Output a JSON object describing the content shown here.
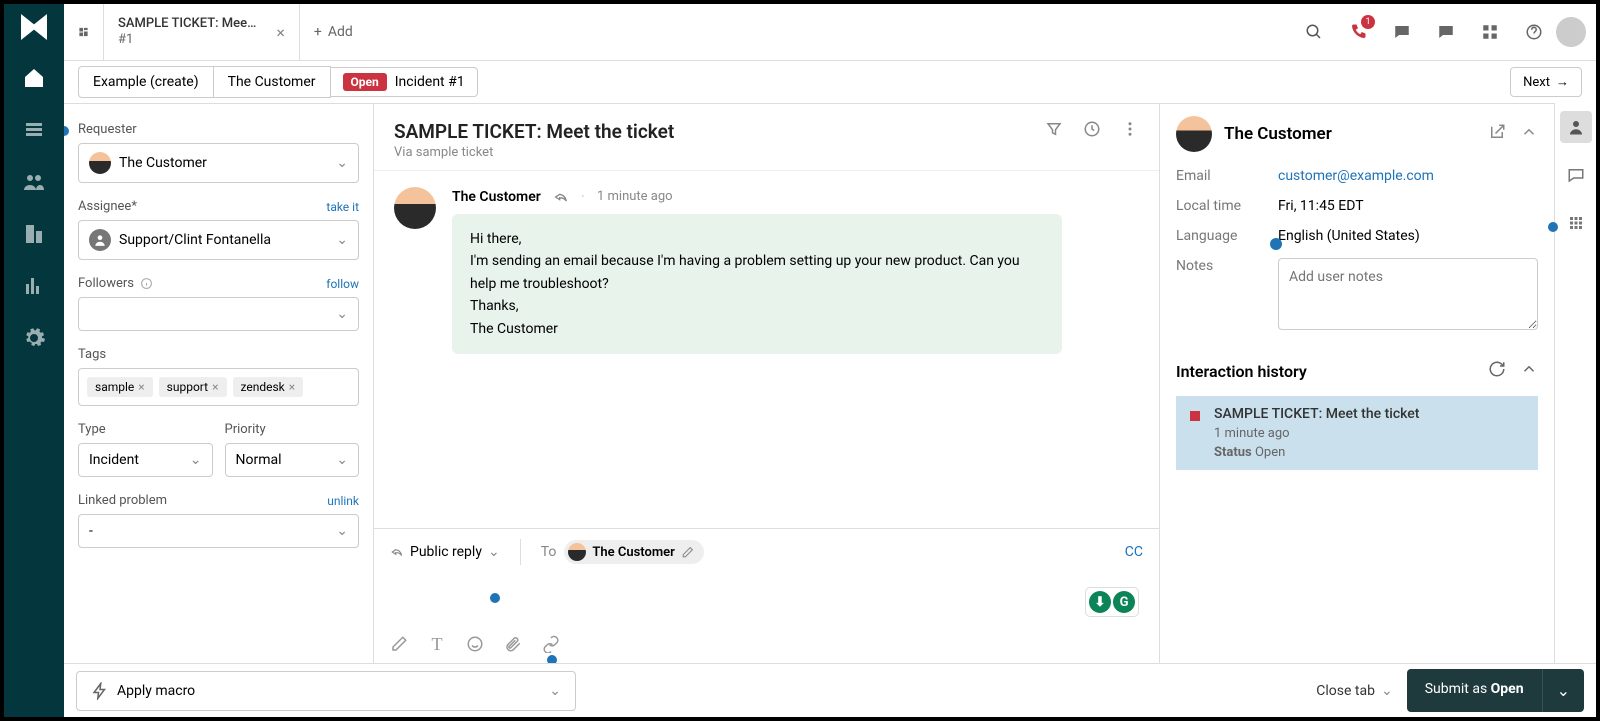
{
  "topbar": {
    "tab": {
      "line1": "SAMPLE TICKET: Mee…",
      "line2": "#1"
    },
    "add": "Add"
  },
  "breadcrumbs": {
    "create": "Example (create)",
    "customer": "The Customer",
    "status": "Open",
    "incident": "Incident #1",
    "next": "Next"
  },
  "left": {
    "requester_label": "Requester",
    "requester_value": "The Customer",
    "assignee_label": "Assignee*",
    "assignee_action": "take it",
    "assignee_value": "Support/Clint Fontanella",
    "followers_label": "Followers",
    "followers_action": "follow",
    "tags_label": "Tags",
    "tags": [
      "sample",
      "support",
      "zendesk"
    ],
    "type_label": "Type",
    "type_value": "Incident",
    "priority_label": "Priority",
    "priority_value": "Normal",
    "linked_label": "Linked problem",
    "linked_action": "unlink",
    "linked_value": "-"
  },
  "ticket": {
    "title": "SAMPLE TICKET: Meet the ticket",
    "via": "Via sample ticket",
    "author": "The Customer",
    "time": "1 minute ago",
    "body": "Hi there,\nI'm sending an email because I'm having a problem setting up your new product. Can you help me troubleshoot?\nThanks,\nThe Customer"
  },
  "reply": {
    "type": "Public reply",
    "to_label": "To",
    "recipient": "The Customer",
    "cc": "CC"
  },
  "profile": {
    "name": "The Customer",
    "email_k": "Email",
    "email_v": "customer@example.com",
    "localtime_k": "Local time",
    "localtime_v": "Fri, 11:45 EDT",
    "lang_k": "Language",
    "lang_v": "English (United States)",
    "notes_k": "Notes",
    "notes_placeholder": "Add user notes"
  },
  "history": {
    "title": "Interaction history",
    "item_title": "SAMPLE TICKET: Meet the ticket",
    "item_time": "1 minute ago",
    "item_status_k": "Status",
    "item_status_v": "Open"
  },
  "footer": {
    "macro": "Apply macro",
    "close": "Close tab",
    "submit_pre": "Submit as ",
    "submit_status": "Open"
  }
}
